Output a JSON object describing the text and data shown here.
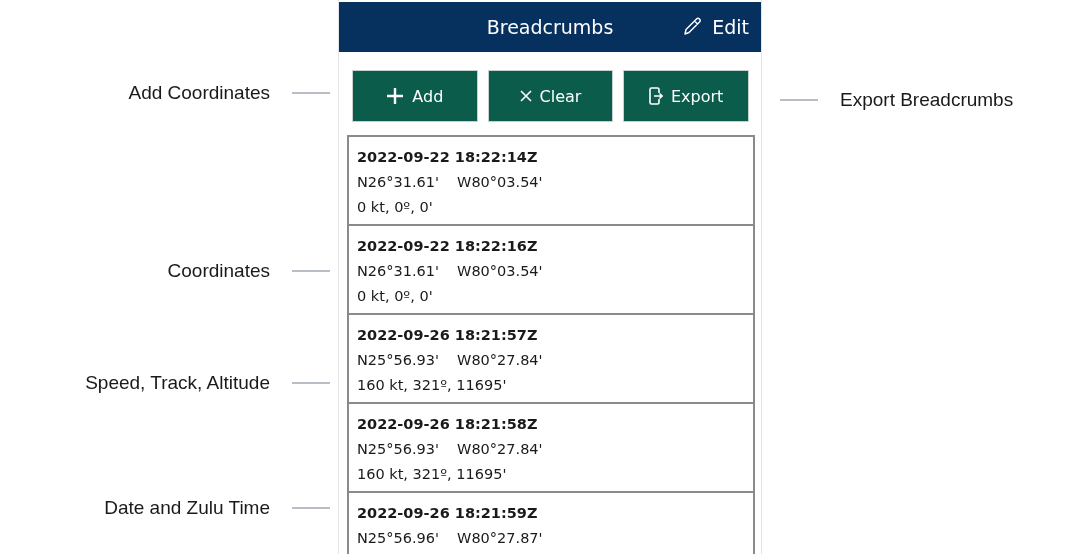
{
  "header": {
    "title": "Breadcrumbs",
    "edit_label": "Edit"
  },
  "buttons": [
    {
      "kind": "add",
      "label": "Add"
    },
    {
      "kind": "clear",
      "label": "Clear"
    },
    {
      "kind": "export",
      "label": "Export"
    }
  ],
  "entries": [
    {
      "timestamp": "2022-09-22 18:22:14Z",
      "latitude": "N26°31.61'",
      "longitude": "W80°03.54'",
      "motion": "0 kt, 0º, 0'"
    },
    {
      "timestamp": "2022-09-22 18:22:16Z",
      "latitude": "N26°31.61'",
      "longitude": "W80°03.54'",
      "motion": "0 kt, 0º, 0'"
    },
    {
      "timestamp": "2022-09-26 18:21:57Z",
      "latitude": "N25°56.93'",
      "longitude": "W80°27.84'",
      "motion": "160 kt, 321º, 11695'"
    },
    {
      "timestamp": "2022-09-26 18:21:58Z",
      "latitude": "N25°56.93'",
      "longitude": "W80°27.84'",
      "motion": "160 kt, 321º, 11695'"
    },
    {
      "timestamp": "2022-09-26 18:21:59Z",
      "latitude": "N25°56.96'",
      "longitude": "W80°27.87'"
    }
  ],
  "left_callouts": [
    "Add Coordinates",
    "Coordinates",
    "Speed, Track, Altitude",
    "Date and Zulu Time"
  ],
  "right_callouts": [
    "Export Breadcrumbs"
  ]
}
